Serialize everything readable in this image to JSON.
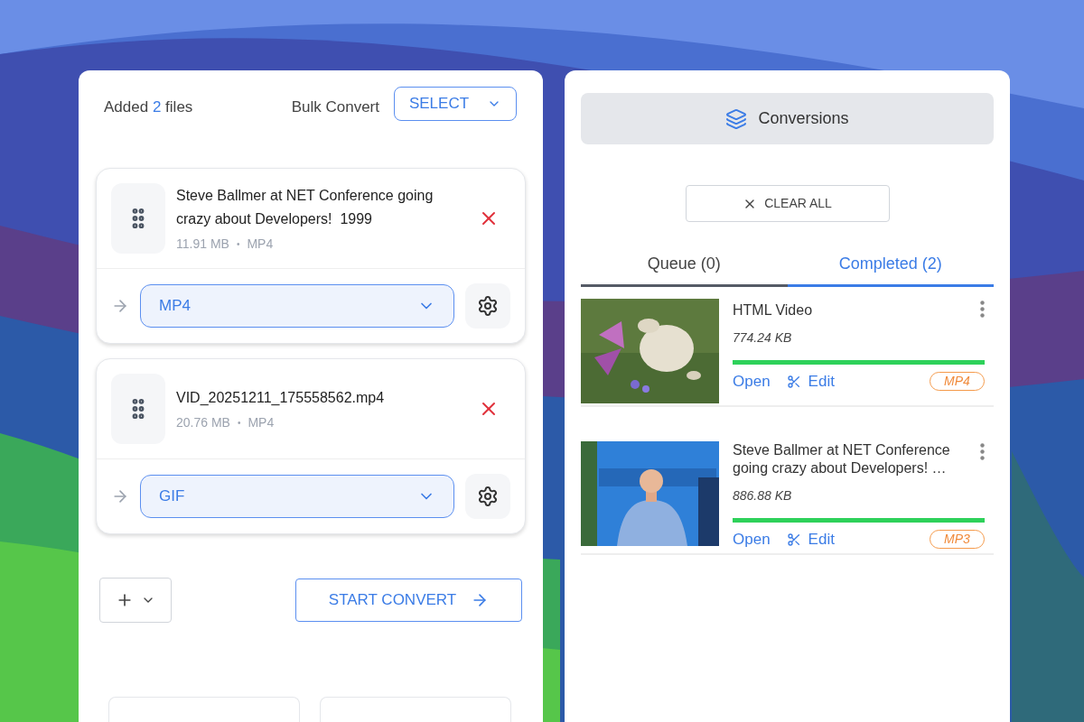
{
  "header": {
    "added_prefix": "Added",
    "added_count": "2",
    "added_suffix": "files",
    "bulk_label": "Bulk Convert",
    "bulk_select": "SELECT"
  },
  "files": [
    {
      "title": "Steve Ballmer at NET Conference going crazy about Developers!  1999",
      "size": "11.91 MB",
      "separator": "•",
      "format": "MP4",
      "target": "MP4"
    },
    {
      "title": "VID_20251211_175558562.mp4",
      "size": "20.76 MB",
      "separator": "•",
      "format": "MP4",
      "target": "GIF"
    }
  ],
  "start_convert": "START CONVERT",
  "conversions_title": "Conversions",
  "clear_all": "CLEAR ALL",
  "tabs": [
    {
      "label": "Queue (0)",
      "selected": false
    },
    {
      "label": "Completed (2)",
      "selected": true
    }
  ],
  "completed": [
    {
      "title": "HTML Video",
      "size": "774.24 KB",
      "level": 1,
      "open": "Open",
      "edit": "Edit",
      "format": "MP4"
    },
    {
      "title": "Steve Ballmer at NET Conference going crazy about Developers! …",
      "size": "886.88 KB",
      "level": 1,
      "open": "Open",
      "edit": "Edit",
      "format": "MP3"
    }
  ]
}
